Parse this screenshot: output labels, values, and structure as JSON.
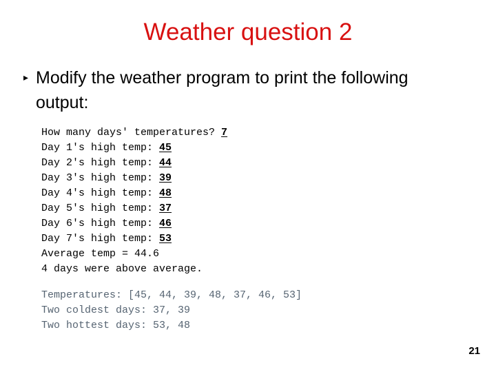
{
  "slide": {
    "title": "Weather question 2",
    "bullet": {
      "marker": "triangle-bullet",
      "text": "Modify the weather program to print the following output:"
    },
    "page_number": "21",
    "colors": {
      "title_red": "#d81111",
      "body_black": "#000000",
      "console_gray": "#566472",
      "background": "#ffffff"
    }
  },
  "console_primary": {
    "lines": [
      {
        "prompt": "How many days' temperatures? ",
        "input": "7"
      },
      {
        "prompt": "Day 1's high temp: ",
        "input": "45"
      },
      {
        "prompt": "Day 2's high temp: ",
        "input": "44"
      },
      {
        "prompt": "Day 3's high temp: ",
        "input": "39"
      },
      {
        "prompt": "Day 4's high temp: ",
        "input": "48"
      },
      {
        "prompt": "Day 5's high temp: ",
        "input": "37"
      },
      {
        "prompt": "Day 6's high temp: ",
        "input": "46"
      },
      {
        "prompt": "Day 7's high temp: ",
        "input": "53"
      },
      {
        "prompt": "Average temp = 44.6",
        "input": ""
      },
      {
        "prompt": "4 days were above average.",
        "input": ""
      }
    ]
  },
  "console_secondary": {
    "lines": [
      {
        "prompt": "Temperatures: [45, 44, 39, 48, 37, 46, 53]",
        "input": ""
      },
      {
        "prompt": "Two coldest days: 37, 39",
        "input": ""
      },
      {
        "prompt": "Two hottest days: 53, 48",
        "input": ""
      }
    ]
  }
}
